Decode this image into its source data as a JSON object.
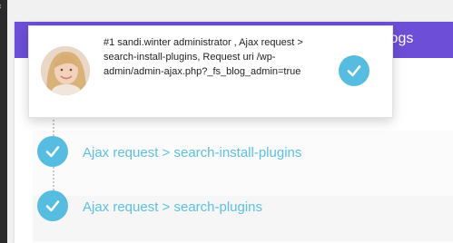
{
  "header": {
    "title": "logs"
  },
  "tooltip": {
    "text": "#1 sandi.winter administrator , Ajax request > search-install-plugins, Request uri /wp-admin/admin-ajax.php?_fs_blog_admin=true",
    "avatar_icon": "user-avatar-photo"
  },
  "log_items": [
    {
      "label": "Ajax request > search-install-plugins"
    },
    {
      "label": "Ajax request > search-plugins"
    }
  ],
  "colors": {
    "header": "#6c4fd6",
    "check": "#56bde0",
    "link": "#5cc0e3"
  }
}
